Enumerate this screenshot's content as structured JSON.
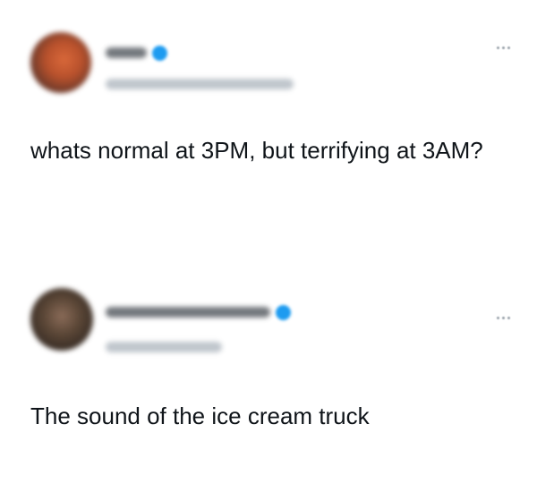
{
  "tweets": [
    {
      "text": "whats normal at 3PM, but terrifying at 3AM?",
      "verified": true,
      "author_name_blurred": true,
      "handle_blurred": true
    },
    {
      "text": "The sound of the ice cream truck",
      "verified": true,
      "author_name_blurred": true,
      "handle_blurred": true
    }
  ],
  "icons": {
    "verified": "verified-badge-icon",
    "more": "more-options-icon"
  },
  "colors": {
    "verified_badge": "#1d9bf0",
    "text": "#0f1419",
    "muted": "#9aa3ab"
  }
}
